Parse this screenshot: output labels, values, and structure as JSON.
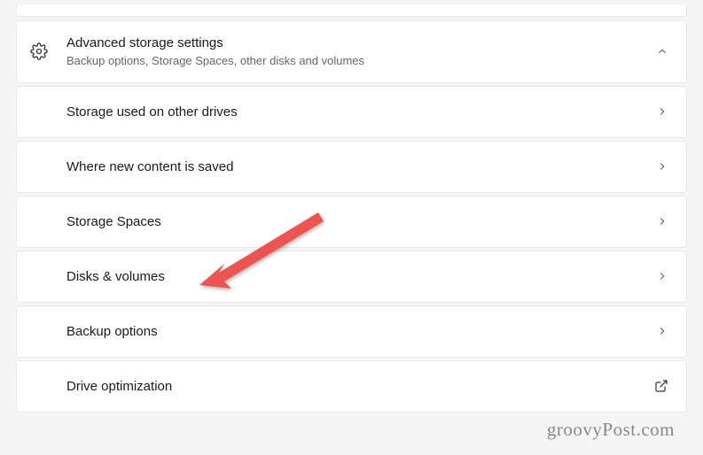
{
  "section": {
    "title": "Advanced storage settings",
    "subtitle": "Backup options, Storage Spaces, other disks and volumes"
  },
  "items": [
    {
      "label": "Storage used on other drives",
      "action": "navigate"
    },
    {
      "label": "Where new content is saved",
      "action": "navigate"
    },
    {
      "label": "Storage Spaces",
      "action": "navigate"
    },
    {
      "label": "Disks & volumes",
      "action": "navigate"
    },
    {
      "label": "Backup options",
      "action": "navigate"
    },
    {
      "label": "Drive optimization",
      "action": "external"
    }
  ],
  "watermark": "groovyPost.com"
}
